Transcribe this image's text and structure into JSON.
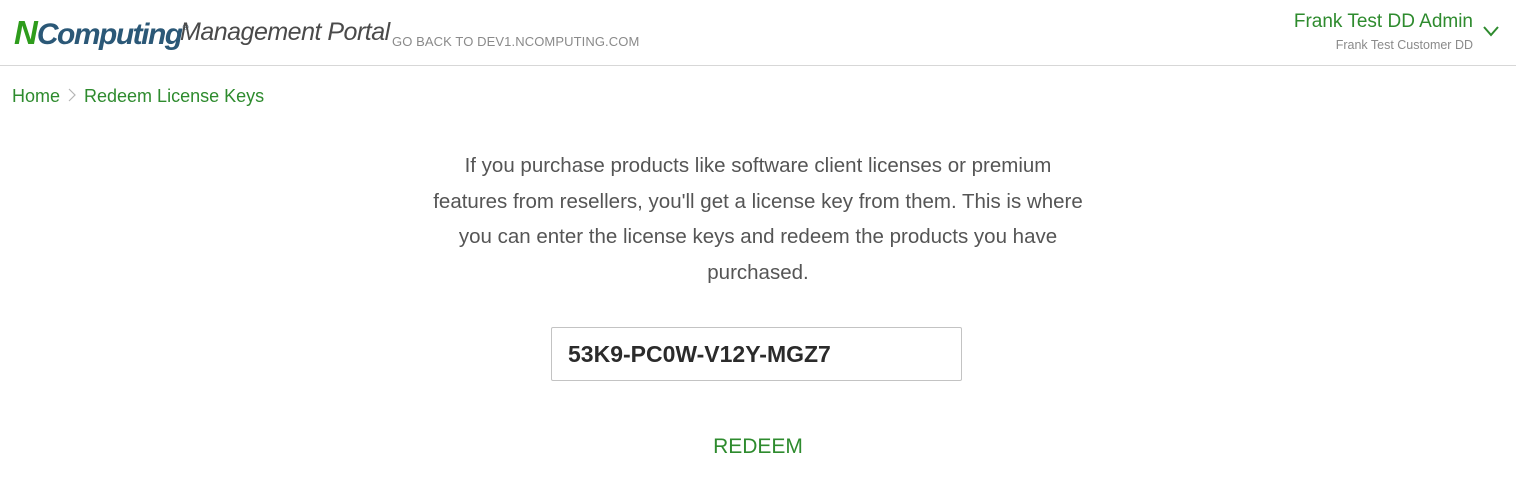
{
  "header": {
    "logo_n": "N",
    "logo_rest": "Computing",
    "logo_reg": "®",
    "portal_title": "Management Portal",
    "go_back_link": "GO BACK TO DEV1.NCOMPUTING.COM",
    "user": {
      "name": "Frank Test DD Admin",
      "customer": "Frank Test Customer DD"
    }
  },
  "breadcrumb": {
    "items": [
      {
        "label": "Home"
      },
      {
        "label": "Redeem License Keys"
      }
    ]
  },
  "main": {
    "description_lines": [
      "If you purchase products like software client licenses or premium",
      "features from resellers, you'll get a license key from them. This is where",
      "you can enter the license keys and redeem the products you have",
      "purchased."
    ],
    "license_key_value": "53K9-PC0W-V12Y-MGZ7",
    "redeem_label": "REDEEM"
  },
  "colors": {
    "accent_green": "#2e8b2e",
    "logo_green": "#2e9c1c",
    "logo_blue": "#2b5877",
    "text_gray": "#555555",
    "divider": "#d7d7d7"
  }
}
